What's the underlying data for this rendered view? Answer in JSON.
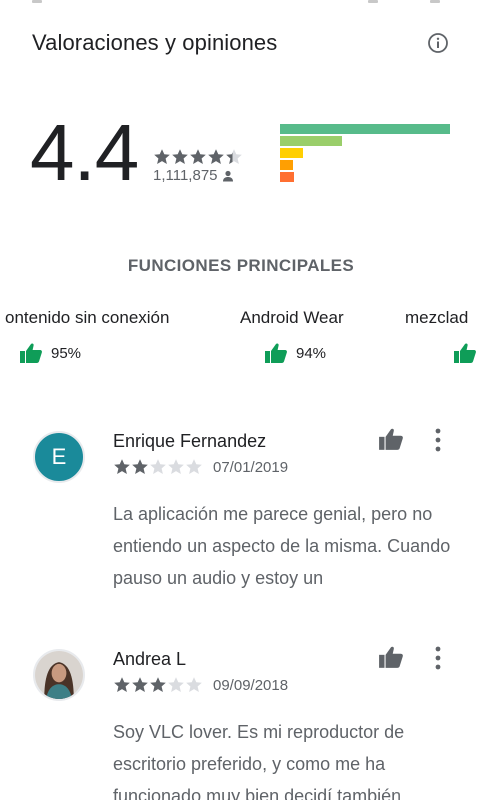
{
  "header": {
    "title": "Valoraciones y opiniones",
    "info_icon": "info-icon"
  },
  "rating_summary": {
    "average": "4.4",
    "stars": 4.4,
    "total_ratings": "1,111,875",
    "distribution_colors": [
      "#57bb8a",
      "#9ace6a",
      "#ffcf02",
      "#ff9f02",
      "#ff6f31"
    ]
  },
  "features": {
    "heading": "FUNCIONES PRINCIPALES",
    "items": [
      {
        "name": "ontenido sin conexión",
        "score": "95%"
      },
      {
        "name": "Android Wear",
        "score": "94%"
      },
      {
        "name": "mezclad",
        "score": ""
      }
    ]
  },
  "reviews": [
    {
      "author": "Enrique Fernandez",
      "avatar_letter": "E",
      "avatar_color": "#1a8a9a",
      "stars": 2,
      "date": "07/01/2019",
      "text": "La aplicación me parece genial, pero no entiendo un aspecto de la misma. Cuando pauso un audio y estoy un"
    },
    {
      "author": "Andrea L",
      "avatar_letter": "",
      "stars": 3,
      "date": "09/09/2018",
      "text": "Soy VLC lover. Es mi reproductor de escritorio preferido, y como me ha funcionado muy bien decidí también"
    }
  ],
  "colors": {
    "accent_green": "#0f9d58",
    "text_primary": "#202124",
    "text_secondary": "#5f6368",
    "star_filled": "#5f6368",
    "star_empty": "#dadce0"
  }
}
